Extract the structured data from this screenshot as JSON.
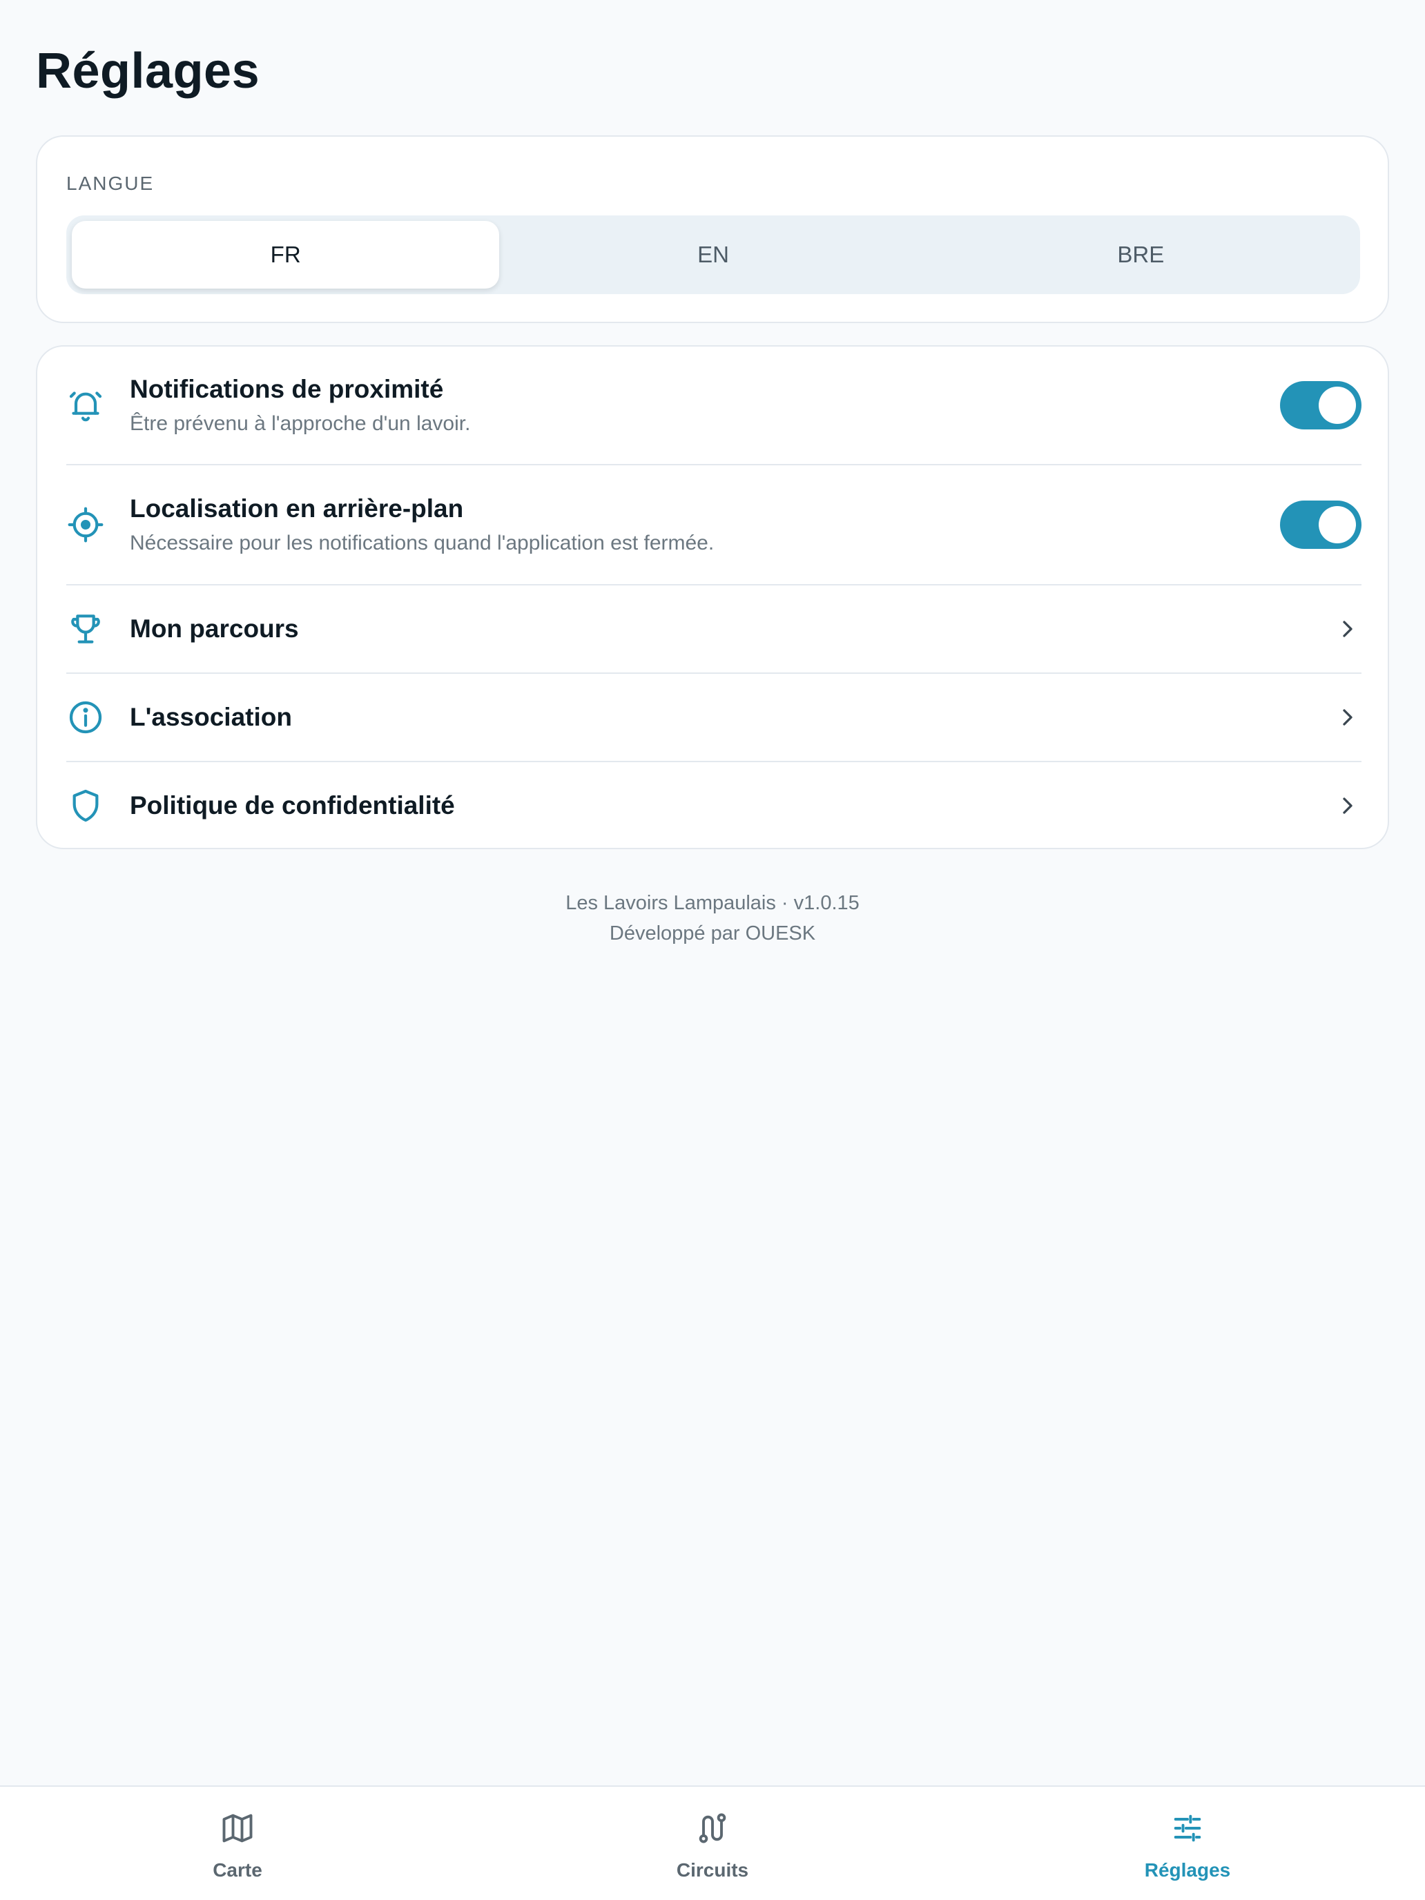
{
  "page": {
    "title": "Réglages"
  },
  "language": {
    "section_label": "LANGUE",
    "options": [
      "FR",
      "EN",
      "BRE"
    ],
    "selected": "FR"
  },
  "settings": {
    "proximity_notifications": {
      "title": "Notifications de proximité",
      "subtitle": "Être prévenu à l'approche d'un lavoir.",
      "enabled": true
    },
    "background_location": {
      "title": "Localisation en arrière-plan",
      "subtitle": "Nécessaire pour les notifications quand l'application est fermée.",
      "enabled": true
    },
    "links": [
      {
        "label": "Mon parcours",
        "icon": "trophy-icon"
      },
      {
        "label": "L'association",
        "icon": "info-icon"
      },
      {
        "label": "Politique de confidentialité",
        "icon": "shield-icon"
      }
    ]
  },
  "footer": {
    "app_version": "Les Lavoirs Lampaulais · v1.0.15",
    "developer": "Développé par OUESK"
  },
  "tabbar": {
    "tabs": [
      {
        "label": "Carte",
        "icon": "map-icon"
      },
      {
        "label": "Circuits",
        "icon": "route-icon"
      },
      {
        "label": "Réglages",
        "icon": "sliders-icon"
      }
    ],
    "active": "Réglages"
  },
  "colors": {
    "accent": "#2393b7",
    "background": "#f8fafc",
    "card": "#ffffff",
    "text_primary": "#0f1b24",
    "text_secondary": "#6b7780"
  }
}
